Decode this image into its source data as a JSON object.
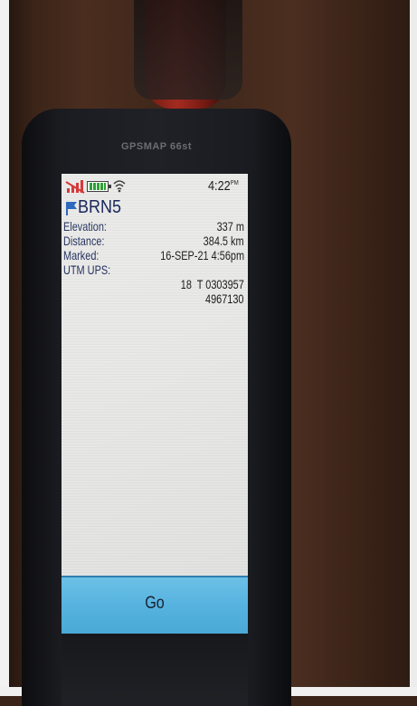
{
  "device": {
    "model": "GPSMAP 66st"
  },
  "status_bar": {
    "time": "4:22",
    "time_suffix": "PM",
    "icons": [
      "no-signal-icon",
      "battery-icon",
      "wifi-icon"
    ]
  },
  "waypoint": {
    "name": "BRN5",
    "icon": "waypoint-flag-icon",
    "elevation_label": "Elevation:",
    "elevation_value": "337 m",
    "distance_label": "Distance:",
    "distance_value": "384.5 km",
    "marked_label": "Marked:",
    "marked_value": "16-SEP-21 4:56pm",
    "utm_label": "UTM UPS:",
    "utm_line1": "18  T 0303957",
    "utm_line2": "4967130"
  },
  "actions": {
    "go_label": "Go"
  },
  "colors": {
    "go_button": "#56b3df",
    "flag": "#1f5fb8",
    "battery": "#1f9a27",
    "signal": "#d22a2a"
  }
}
